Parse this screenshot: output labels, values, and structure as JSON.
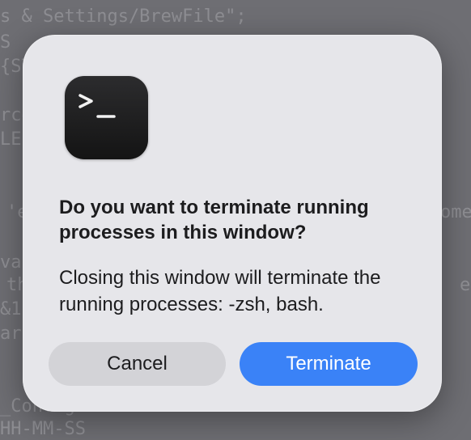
{
  "background_terminal": {
    "lines": [
      "s & Settings/BrewFile\";",
      "S",
      "{ST",
      "rce",
      "LE",
      "'e",
      "ome",
      "vai",
      "th",
      "e",
      "&1",
      "arc",
      "_Config",
      "HH-MM-SS"
    ]
  },
  "dialog": {
    "icon": "terminal-app-icon",
    "title": "Do you want to terminate running processes in this window?",
    "message": "Closing this window will terminate the running processes: -zsh, bash.",
    "buttons": {
      "cancel_label": "Cancel",
      "terminate_label": "Terminate"
    }
  },
  "colors": {
    "accent": "#3a82f7",
    "dialog_background": "#e6e6ea",
    "cancel_button": "#d3d3d7"
  }
}
